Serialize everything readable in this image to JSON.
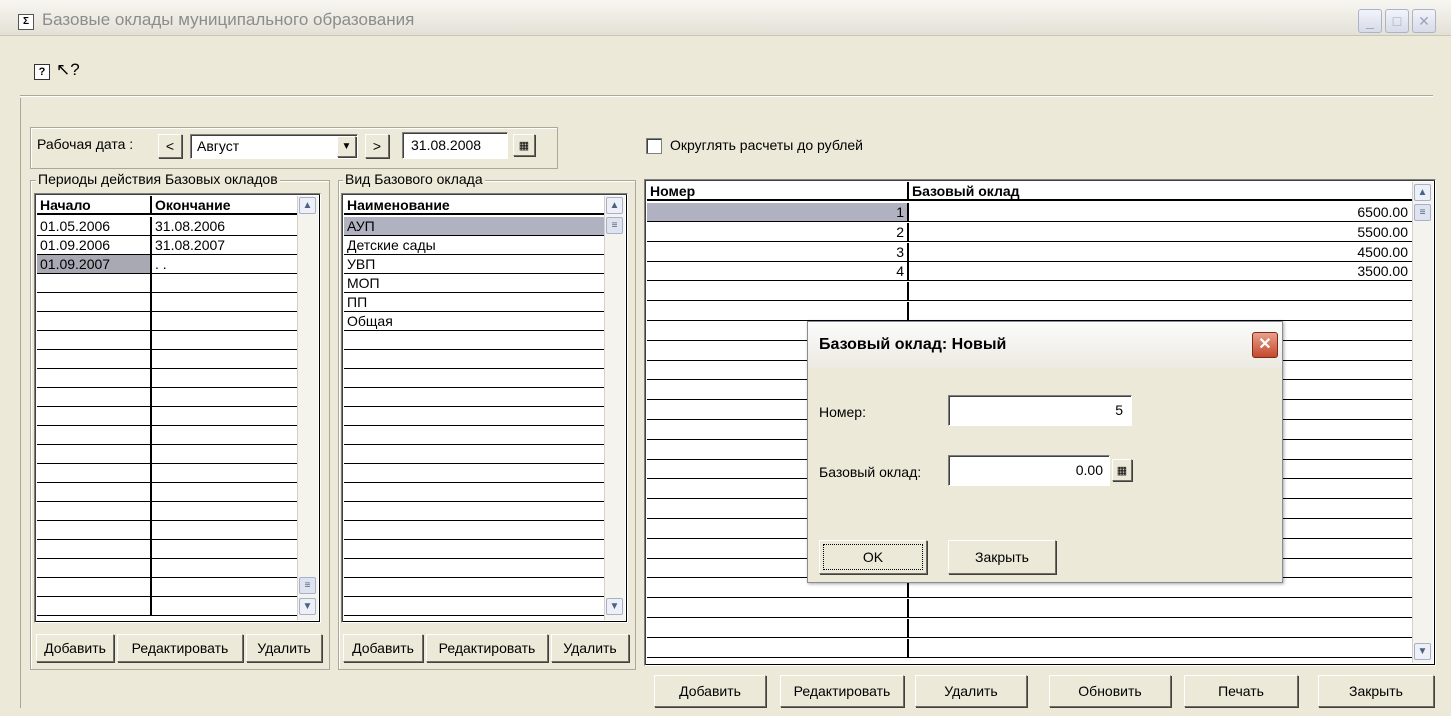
{
  "window": {
    "title": "Базовые оклады муниципального образования",
    "minimize": "_",
    "maximize": "□",
    "close": "✕"
  },
  "toolbar": {
    "help": "?",
    "whats_this": "↖?"
  },
  "work_date": {
    "label": "Рабочая дата :",
    "prev": "<",
    "next": ">",
    "month": "Август",
    "date": "31.08.2008"
  },
  "round_checkbox": {
    "label": "Округлять расчеты до рублей",
    "checked": false
  },
  "periods": {
    "group_label": "Периоды действия Базовых окладов",
    "columns": [
      "Начало",
      "Окончание"
    ],
    "rows": [
      [
        "01.05.2006",
        "31.08.2006"
      ],
      [
        "01.09.2006",
        "31.08.2007"
      ],
      [
        "01.09.2007",
        ". ."
      ]
    ],
    "buttons": {
      "add": "Добавить",
      "edit": "Редактировать",
      "delete": "Удалить"
    }
  },
  "types": {
    "group_label": "Вид Базового оклада",
    "columns": [
      "Наименование"
    ],
    "rows": [
      "АУП",
      "Детские сады",
      "УВП",
      "МОП",
      "ПП",
      "Общая"
    ],
    "buttons": {
      "add": "Добавить",
      "edit": "Редактировать",
      "delete": "Удалить"
    }
  },
  "salaries": {
    "columns": [
      "Номер",
      "Базовый оклад"
    ],
    "rows": [
      [
        "1",
        "6500.00"
      ],
      [
        "2",
        "5500.00"
      ],
      [
        "3",
        "4500.00"
      ],
      [
        "4",
        "3500.00"
      ]
    ]
  },
  "bottom_buttons": {
    "add": "Добавить",
    "edit": "Редактировать",
    "delete": "Удалить",
    "refresh": "Обновить",
    "print": "Печать",
    "close": "Закрыть"
  },
  "dialog": {
    "title": "Базовый оклад: Новый",
    "number_label": "Номер:",
    "number_value": "5",
    "salary_label": "Базовый оклад:",
    "salary_value": "0.00",
    "ok": "OK",
    "close": "Закрыть"
  },
  "colors": {
    "selected_row": "#a9a9b4",
    "selected_row_blue": "#b0b2c2"
  }
}
